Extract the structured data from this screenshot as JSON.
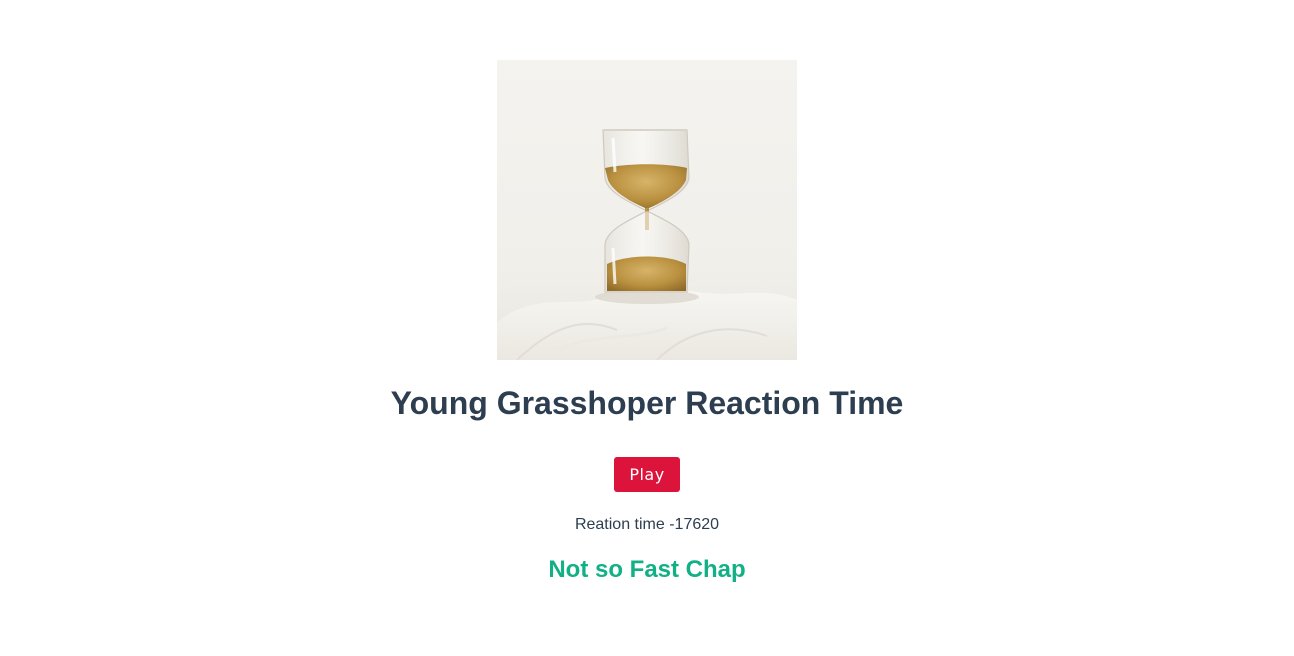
{
  "image": {
    "icon": "hourglass-image"
  },
  "heading": "Young Grasshoper Reaction Time",
  "play_button": {
    "label": "Play"
  },
  "reaction": {
    "text": "Reation time -17620"
  },
  "result": {
    "message": "Not so Fast Chap"
  },
  "colors": {
    "title": "#2c3e50",
    "button_bg": "#dc143c",
    "button_text": "#ffffff",
    "result": "#12b086"
  }
}
